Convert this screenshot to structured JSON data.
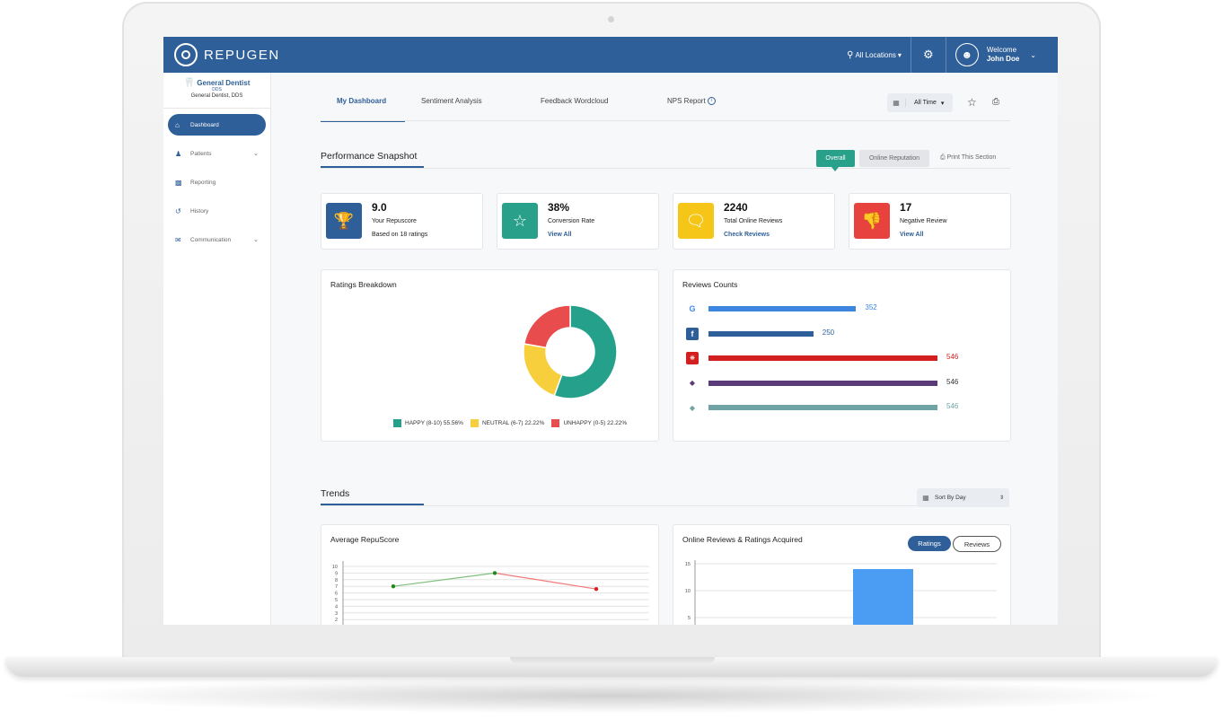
{
  "brand": {
    "name": "REPUGEN"
  },
  "topbar": {
    "locations_label": "All Locations",
    "welcome_label": "Welcome",
    "user_name": "John Doe"
  },
  "clinic": {
    "logo_text": "General Dentist",
    "logo_sub": "DDS",
    "name": "General Dentist, DDS"
  },
  "sidebar": {
    "items": [
      {
        "label": "Dashboard",
        "icon": "home-icon",
        "active": true
      },
      {
        "label": "Patients",
        "icon": "users-icon",
        "expandable": true
      },
      {
        "label": "Reporting",
        "icon": "bar-chart-icon"
      },
      {
        "label": "History",
        "icon": "history-icon"
      },
      {
        "label": "Communication",
        "icon": "mail-icon",
        "expandable": true
      }
    ]
  },
  "tabs": [
    {
      "label": "My Dashboard",
      "active": true
    },
    {
      "label": "Sentiment Analysis"
    },
    {
      "label": "Feedback Wordcloud"
    },
    {
      "label": "NPS Report"
    }
  ],
  "time_filter": {
    "value": "All Time"
  },
  "performance": {
    "title": "Performance Snapshot",
    "segment_overall": "Overall",
    "segment_online": "Online Reputation",
    "print_section": "Print This Section",
    "cards": [
      {
        "value": "9.0",
        "label": "Your Repuscore",
        "sub": "Based on 18 ratings",
        "color": "#2f5f98",
        "icon": "trophy-icon"
      },
      {
        "value": "38%",
        "label": "Conversion Rate",
        "link": "View All",
        "color": "#28a08a",
        "icon": "star-icon"
      },
      {
        "value": "2240",
        "label": "Total Online Reviews",
        "link": "Check Reviews",
        "color": "#f5c518",
        "icon": "chat-icon"
      },
      {
        "value": "17",
        "label": "Negative Review",
        "link": "View All",
        "color": "#e8423f",
        "icon": "thumbs-down-icon"
      }
    ]
  },
  "ratings_breakdown": {
    "title": "Ratings Breakdown",
    "legend": [
      {
        "label": "HAPPY (8-10)",
        "pct": "55.56%",
        "color": "#24a08b"
      },
      {
        "label": "NEUTRAL (6-7)",
        "pct": "22.22%",
        "color": "#f7cf3c"
      },
      {
        "label": "UNHAPPY (0-5)",
        "pct": "22.22%",
        "color": "#e84c4c"
      }
    ]
  },
  "reviews_counts": {
    "title": "Reviews Counts",
    "rows": [
      {
        "source": "google",
        "icon": "google-icon",
        "value": "352",
        "color": "#3c86e0",
        "label_color": "#3c86e0"
      },
      {
        "source": "facebook",
        "icon": "facebook-icon",
        "value": "250",
        "color": "#2f5f98",
        "label_color": "#2f5f98"
      },
      {
        "source": "yelp",
        "icon": "yelp-icon",
        "value": "546",
        "color": "#d21f1f",
        "label_color": "#d21f1f"
      },
      {
        "source": "other",
        "icon": "review-site-icon",
        "value": "546",
        "color": "#5b3a7a",
        "label_color": "#333333"
      },
      {
        "source": "other2",
        "icon": "review-site-icon",
        "value": "546",
        "color": "#6fa3a6",
        "label_color": "#6fa3a6"
      }
    ]
  },
  "trends": {
    "title": "Trends",
    "sort_label": "Sort By Day",
    "avg_repuscore_title": "Average RepuScore",
    "online_reviews_title": "Online Reviews & Ratings Acquired",
    "pill_ratings": "Ratings",
    "pill_reviews": "Reviews"
  },
  "chart_data": [
    {
      "type": "pie",
      "labels": [
        "HAPPY (8-10)",
        "NEUTRAL (6-7)",
        "UNHAPPY (0-5)"
      ],
      "values": [
        55.56,
        22.22,
        22.22
      ],
      "colors": [
        "#24a08b",
        "#f7cf3c",
        "#e84c4c"
      ]
    },
    {
      "type": "bar",
      "categories": [
        "google",
        "facebook",
        "yelp",
        "other",
        "other2"
      ],
      "values": [
        352,
        250,
        546,
        546,
        546
      ],
      "xlim": [
        0,
        546
      ]
    },
    {
      "type": "line",
      "x": [
        1,
        2,
        3
      ],
      "y": [
        7,
        9,
        6.6
      ],
      "ylim": [
        2,
        10
      ],
      "yticks": [
        "10",
        "9",
        "8",
        "7",
        "6",
        "5",
        "4",
        "3",
        "2"
      ],
      "segment_colors": [
        "#7ec07e",
        "#f07b7b"
      ],
      "point_colors": [
        "#1e8a1e",
        "#1e8a1e",
        "#d62020"
      ],
      "grid": true
    },
    {
      "type": "bar",
      "values": [
        14
      ],
      "ylim": [
        0,
        15
      ],
      "yticks": [
        "15",
        "10",
        "5"
      ],
      "color": "#4a9df2",
      "grid": true
    }
  ]
}
